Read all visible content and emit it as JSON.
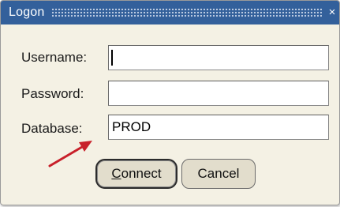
{
  "window": {
    "title": "Logon",
    "close_glyph": "×"
  },
  "form": {
    "username_label": "Username:",
    "username_value": "",
    "password_label": "Password:",
    "password_value": "",
    "database_label": "Database:",
    "database_value": "PROD"
  },
  "buttons": {
    "connect_mnemonic": "C",
    "connect_rest": "onnect",
    "cancel_label": "Cancel"
  },
  "annotation": {
    "arrow_icon": "red-arrow-icon",
    "arrow_color": "#c8202a"
  },
  "colors": {
    "titlebar": "#33609b",
    "dialog_bg": "#f4f1e4",
    "button_bg": "#e2ddcc"
  }
}
